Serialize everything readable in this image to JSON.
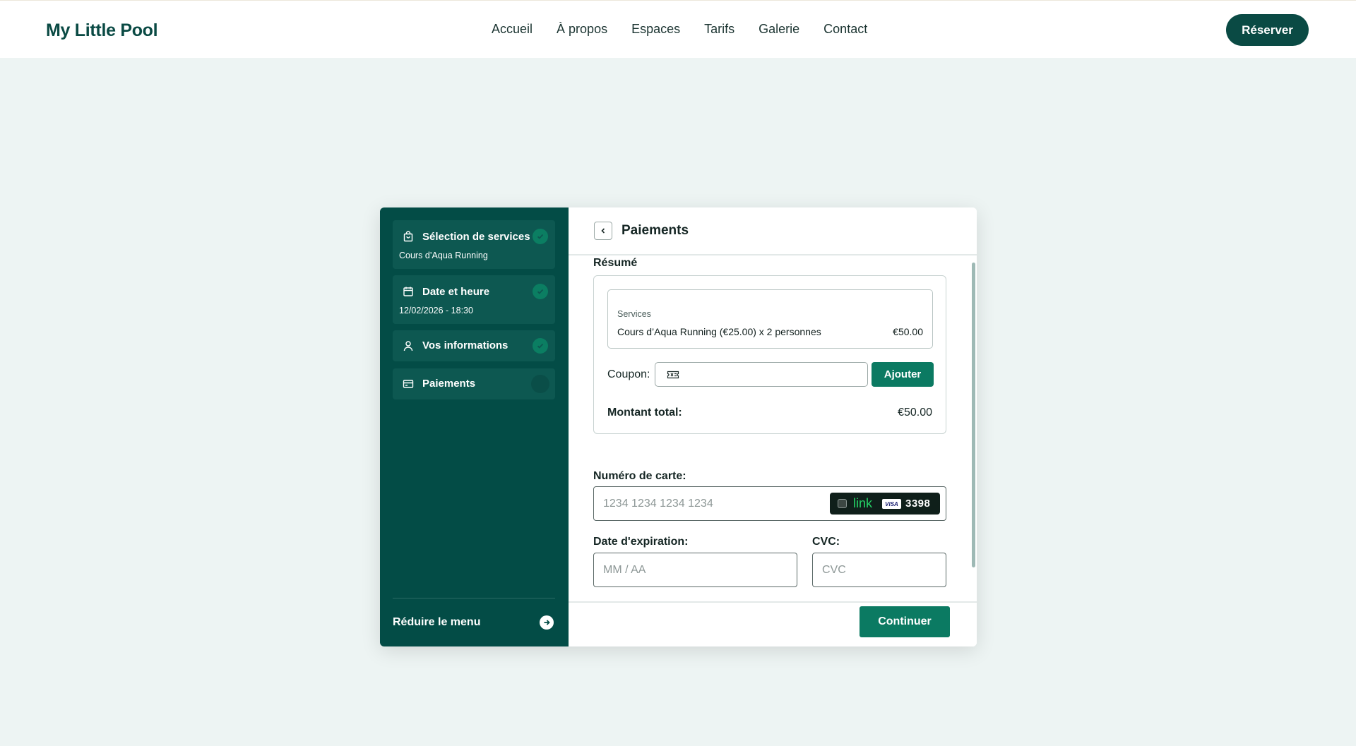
{
  "header": {
    "logo": "My Little Pool",
    "nav": [
      "Accueil",
      "À propos",
      "Espaces",
      "Tarifs",
      "Galerie",
      "Contact"
    ],
    "reserve_label": "Réserver"
  },
  "sidebar": {
    "steps": [
      {
        "title": "Sélection de services",
        "sub": "Cours d’Aqua Running",
        "icon": "shopping-bag-icon",
        "status": "done"
      },
      {
        "title": "Date et heure",
        "sub": "12/02/2026 - 18:30",
        "icon": "calendar-icon",
        "status": "done"
      },
      {
        "title": "Vos informations",
        "sub": "",
        "icon": "user-icon",
        "status": "done"
      },
      {
        "title": "Paiements",
        "sub": "",
        "icon": "credit-card-icon",
        "status": "current"
      }
    ],
    "collapse_label": "Réduire le menu"
  },
  "panel": {
    "title": "Paiements",
    "summary_title": "Résumé",
    "services_label": "Services",
    "service_line": "Cours d’Aqua Running (€25.00) x 2 personnes",
    "service_price": "€50.00",
    "coupon_label": "Coupon:",
    "coupon_value": "",
    "add_label": "Ajouter",
    "total_label": "Montant total:",
    "total_value": "€50.00",
    "card_number_label": "Numéro de carte:",
    "card_number_placeholder": "1234 1234 1234 1234",
    "link_text": "link",
    "card_brand": "VISA",
    "card_last4": "3398",
    "expiry_label": "Date d'expiration:",
    "expiry_placeholder": "MM / AA",
    "cvc_label": "CVC:",
    "cvc_placeholder": "CVC",
    "continue_label": "Continuer"
  },
  "colors": {
    "brand_dark": "#034c46",
    "accent_green": "#0b7a62",
    "page_background": "#edf4f3",
    "link_green": "#25d366"
  }
}
